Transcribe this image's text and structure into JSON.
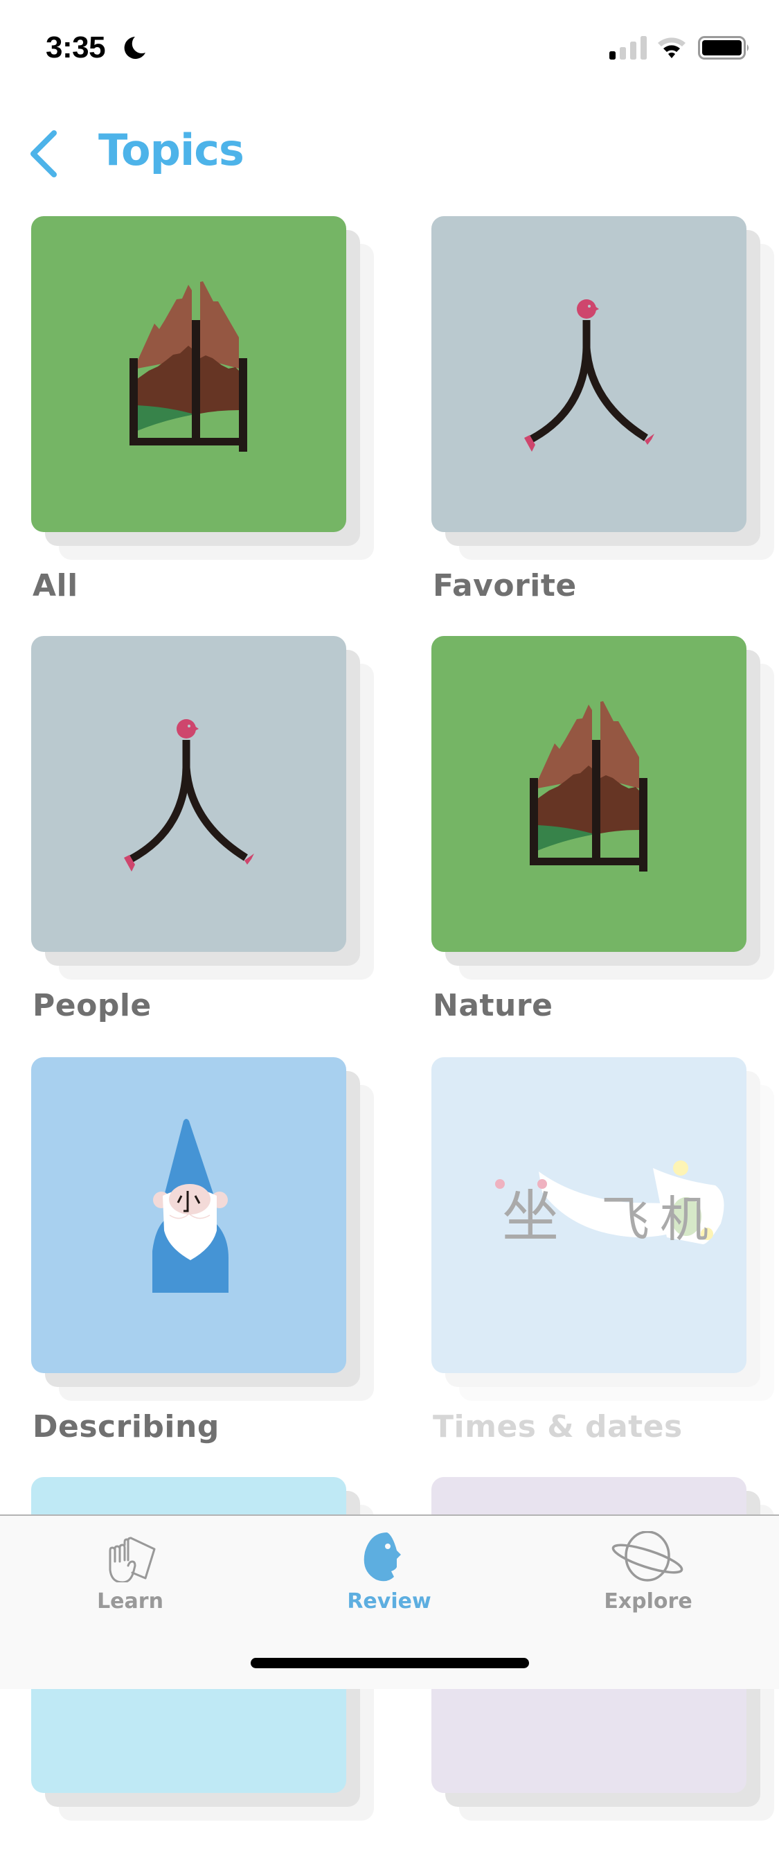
{
  "status_bar": {
    "time": "3:35",
    "focus_icon": "moon-icon",
    "signal_bars_filled": 1,
    "signal_bars_total": 4,
    "wifi_arcs_filled": 2,
    "wifi_arcs_total": 3,
    "battery_level": 0.95
  },
  "header": {
    "back_icon": "chevron-left-icon",
    "title": "Topics",
    "accent_color": "#4DB3E9"
  },
  "topics": [
    {
      "label": "All",
      "illustration": "mountain-character-icon",
      "bg": "#75B565",
      "enabled": true
    },
    {
      "label": "Favorite",
      "illustration": "person-character-icon",
      "bg": "#BAC9CF",
      "enabled": true
    },
    {
      "label": "People",
      "illustration": "person-character-icon",
      "bg": "#BAC9CF",
      "enabled": true
    },
    {
      "label": "Nature",
      "illustration": "mountain-character-icon",
      "bg": "#75B565",
      "enabled": true
    },
    {
      "label": "Describing",
      "illustration": "gnome-small-character-icon",
      "bg": "#A8D0EF",
      "enabled": true
    },
    {
      "label": "Times & dates",
      "illustration": "airplane-characters-icon",
      "illustration_text": [
        "坐",
        "飞",
        "机"
      ],
      "bg": "#DCEBF7",
      "enabled": false
    },
    {
      "label": "",
      "illustration": "",
      "bg": "#BFE9F5",
      "enabled": true
    },
    {
      "label": "",
      "illustration": "",
      "bg": "#E8E3EF",
      "enabled": true
    }
  ],
  "tab_bar": {
    "tabs": [
      {
        "label": "Learn",
        "icon": "hand-card-icon",
        "active": false
      },
      {
        "label": "Review",
        "icon": "face-profile-icon",
        "active": true
      },
      {
        "label": "Explore",
        "icon": "planet-icon",
        "active": false
      }
    ],
    "active_color": "#5DAEE0",
    "inactive_color": "#999999"
  }
}
